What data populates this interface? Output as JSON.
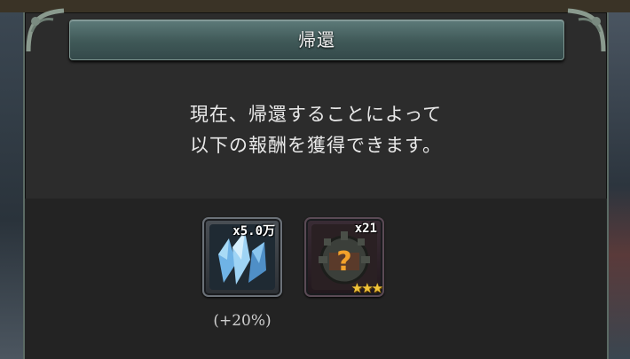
{
  "dialog": {
    "title": "帰還",
    "message_line1": "現在、帰還することによって",
    "message_line2": "以下の報酬を獲得できます。"
  },
  "rewards": [
    {
      "icon": "blue-crystal-icon",
      "count": "x5.0万",
      "bonus": "(+20%)"
    },
    {
      "icon": "mystery-gear-chest-icon",
      "count": "x21",
      "stars": "★★★"
    }
  ],
  "colors": {
    "title_bar": "#3f5857",
    "dialog_bg": "#2c2c2c",
    "star": "#f0c33a"
  }
}
